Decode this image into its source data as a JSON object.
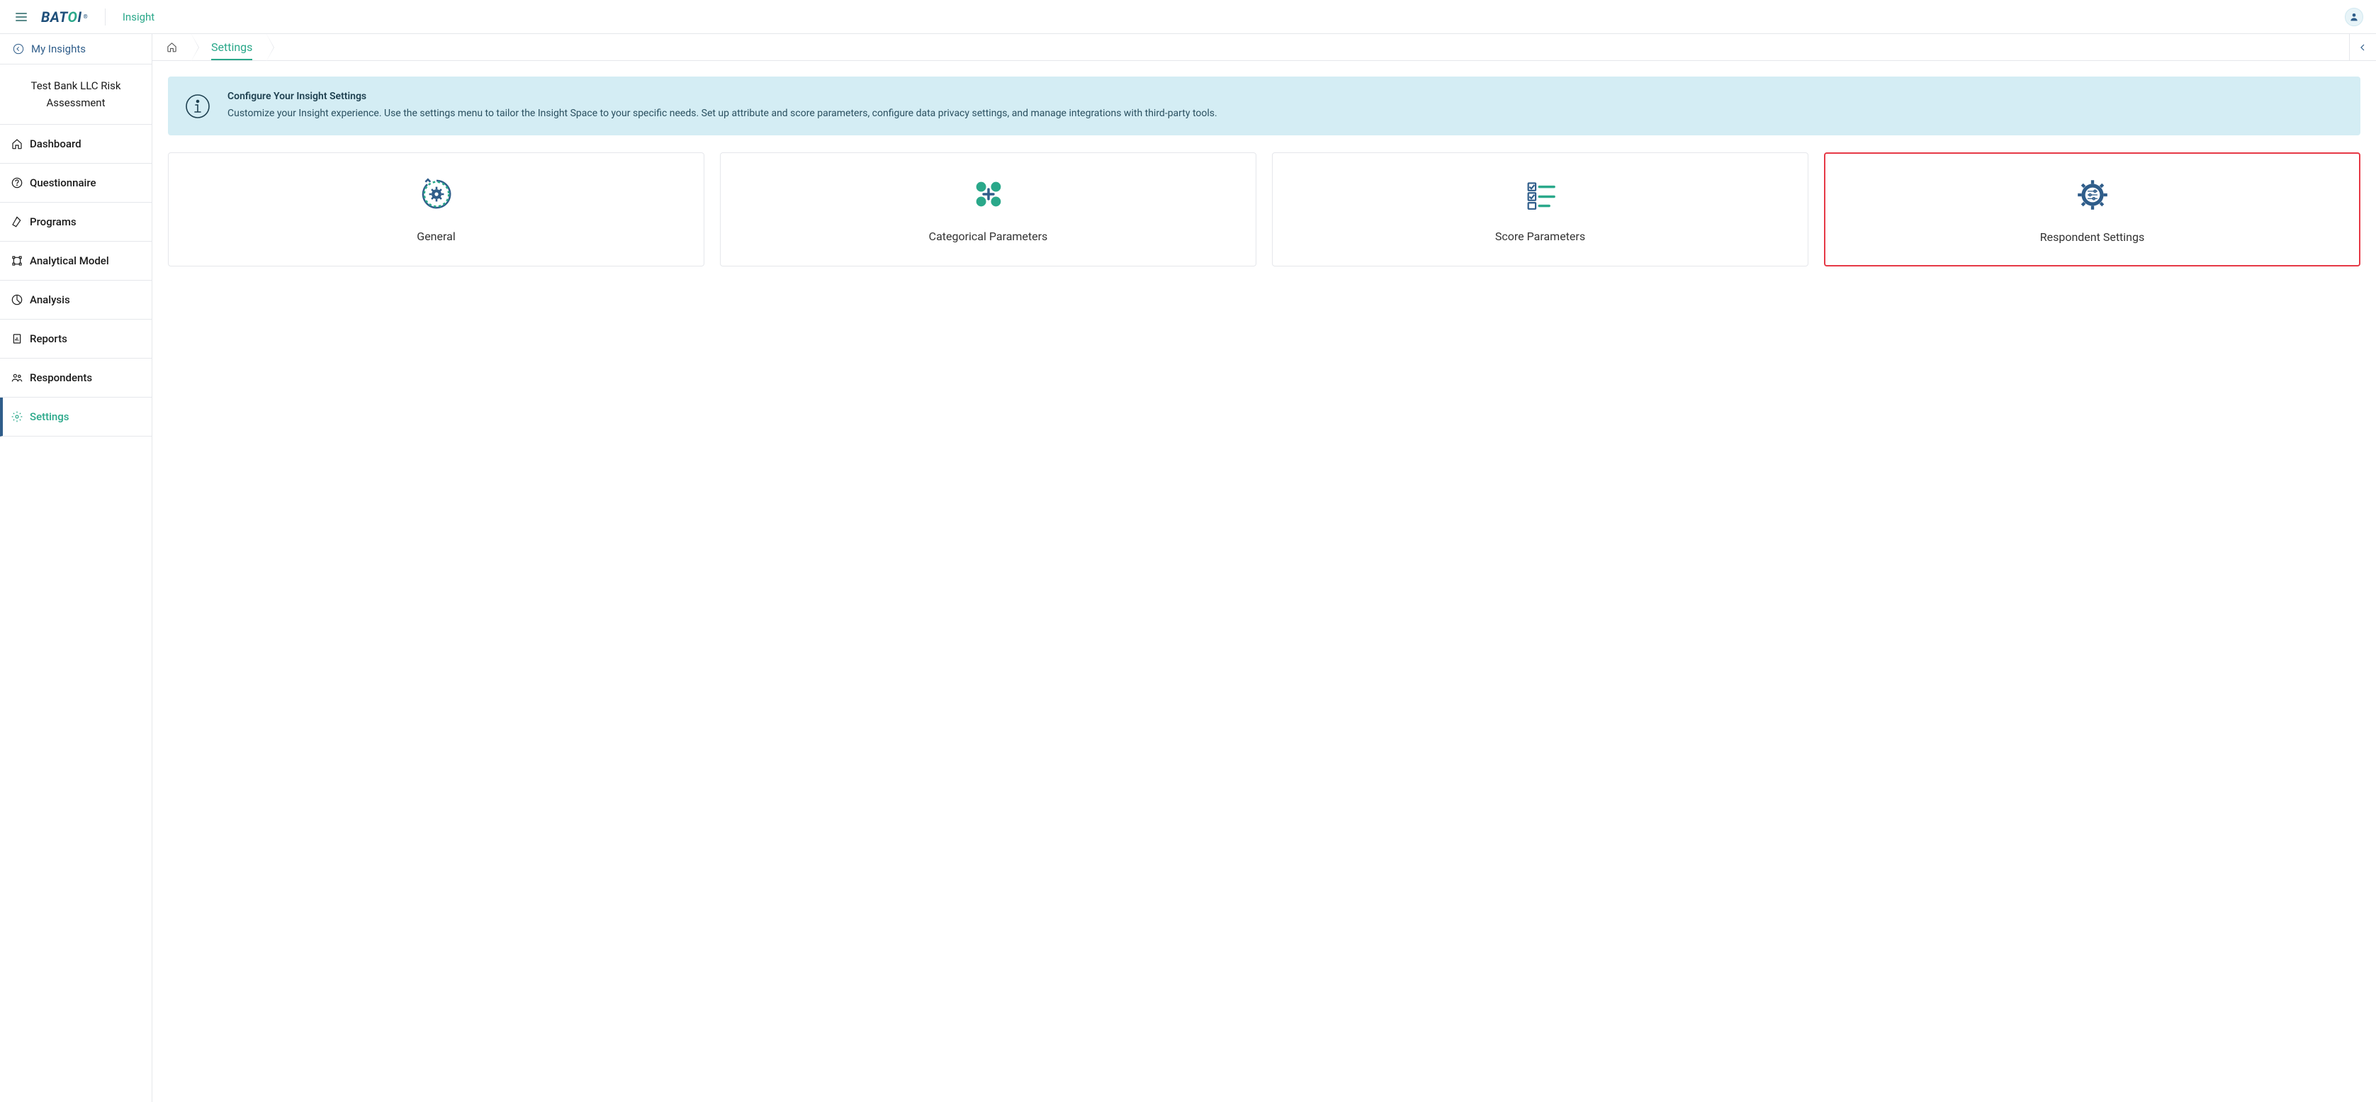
{
  "header": {
    "app_name": "Insight"
  },
  "sidebar": {
    "back_label": "My Insights",
    "project_name": "Test Bank LLC Risk Assessment",
    "nav": [
      {
        "label": "Dashboard"
      },
      {
        "label": "Questionnaire"
      },
      {
        "label": "Programs"
      },
      {
        "label": "Analytical Model"
      },
      {
        "label": "Analysis"
      },
      {
        "label": "Reports"
      },
      {
        "label": "Respondents"
      },
      {
        "label": "Settings"
      }
    ]
  },
  "breadcrumb": {
    "current": "Settings"
  },
  "banner": {
    "title": "Configure Your Insight Settings",
    "description": "Customize your Insight experience. Use the settings menu to tailor the Insight Space to your specific needs. Set up attribute and score parameters, configure data privacy settings, and manage integrations with third-party tools."
  },
  "cards": [
    {
      "title": "General"
    },
    {
      "title": "Categorical Parameters"
    },
    {
      "title": "Score Parameters"
    },
    {
      "title": "Respondent Settings"
    }
  ]
}
